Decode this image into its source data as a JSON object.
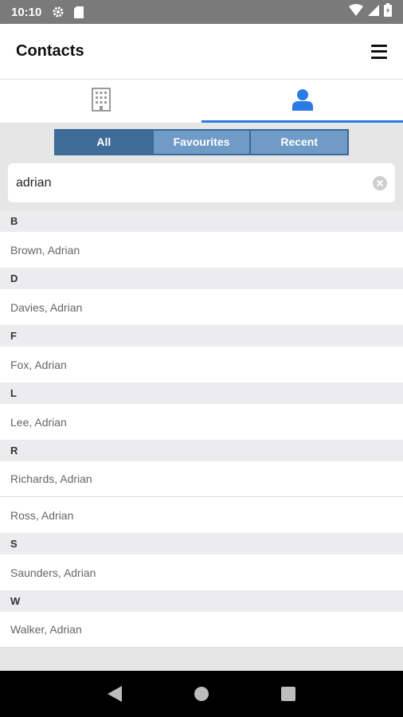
{
  "status_bar": {
    "time": "10:10",
    "icons": [
      "settings-icon",
      "sd-card-icon",
      "wifi-icon",
      "signal-icon",
      "battery-icon"
    ]
  },
  "app_bar": {
    "title": "Contacts",
    "menu_icon": "hamburger-menu-icon"
  },
  "tabs": [
    {
      "icon": "building-icon",
      "active": false
    },
    {
      "icon": "person-icon",
      "active": true
    }
  ],
  "filter": {
    "options": [
      "All",
      "Favourites",
      "Recent"
    ],
    "selected": "All"
  },
  "search": {
    "value": "adrian"
  },
  "contacts": [
    {
      "letter": "B",
      "names": [
        "Brown, Adrian"
      ]
    },
    {
      "letter": "D",
      "names": [
        "Davies, Adrian"
      ]
    },
    {
      "letter": "F",
      "names": [
        "Fox, Adrian"
      ]
    },
    {
      "letter": "L",
      "names": [
        "Lee, Adrian"
      ]
    },
    {
      "letter": "R",
      "names": [
        "Richards, Adrian",
        "Ross, Adrian"
      ]
    },
    {
      "letter": "S",
      "names": [
        "Saunders, Adrian"
      ]
    },
    {
      "letter": "W",
      "names": [
        "Walker, Adrian"
      ]
    }
  ],
  "colors": {
    "accent": "#2a7be4",
    "segment_active": "#3f6b98",
    "segment_inactive": "#6f9bc6"
  }
}
